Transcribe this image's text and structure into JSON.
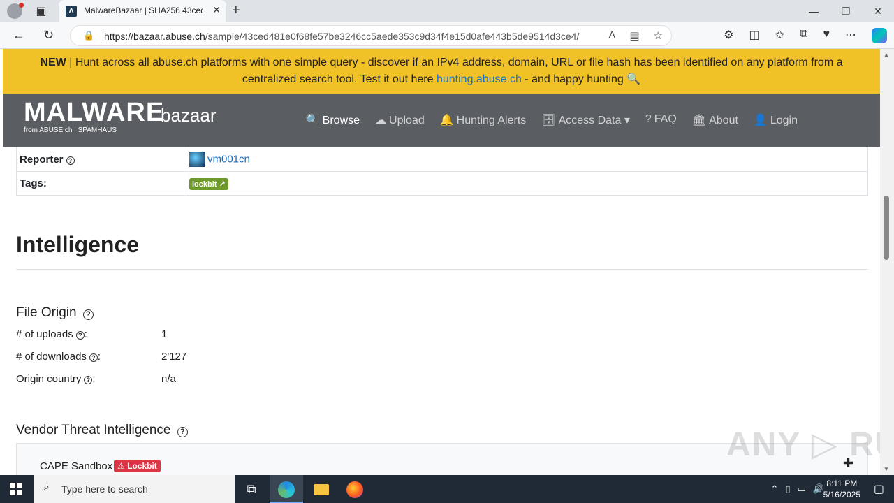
{
  "browser": {
    "tab_title": "MalwareBazaar | SHA256 43ced4(",
    "tab_favicon": "Λ",
    "url_host": "https://bazaar.abuse.ch",
    "url_path": "/sample/43ced481e0f68fe57be3246cc5aede353c9d34f4e15d0afe443b5de9514d3ce4/"
  },
  "banner": {
    "new_label": "NEW",
    "text_before": " | Hunt across all abuse.ch platforms with one simple query - discover if an IPv4 address, domain, URL or file hash has been identified on any platform from a centralized search tool. Test it out here ",
    "link_text": "hunting.abuse.ch",
    "text_after": " - and happy hunting 🔍"
  },
  "navbar": {
    "logo_main": "MALWARE",
    "logo_bazaar": "bazaar",
    "logo_sub": "from ABUSE.ch | SPAMHAUS",
    "items": [
      {
        "label": "Browse",
        "icon": "🔍"
      },
      {
        "label": "Upload",
        "icon": "☁"
      },
      {
        "label": "Hunting Alerts",
        "icon": "🔔"
      },
      {
        "label": "Access Data",
        "icon": "🗄"
      },
      {
        "label": "FAQ",
        "icon": "?"
      },
      {
        "label": "About",
        "icon": "🏛"
      },
      {
        "label": "Login",
        "icon": "👤"
      }
    ]
  },
  "meta_table": {
    "reporter_label": "Reporter",
    "reporter_value": "vm001cn",
    "tags_label": "Tags:",
    "tag": "lockbit ↗"
  },
  "intelligence": {
    "heading": "Intelligence",
    "file_origin_heading": "File Origin",
    "rows": [
      {
        "label": "# of uploads",
        "value": "1"
      },
      {
        "label": "# of downloads",
        "value": "2'127"
      },
      {
        "label": "Origin country",
        "value": "n/a"
      }
    ],
    "vendor_heading": "Vendor Threat Intelligence",
    "vendor_name": "CAPE Sandbox",
    "vendor_badge": "Lockbit"
  },
  "watermark": "ANY ▷ RUN",
  "taskbar": {
    "search_placeholder": "Type here to search",
    "time": "8:11 PM",
    "date": "5/16/2025"
  }
}
